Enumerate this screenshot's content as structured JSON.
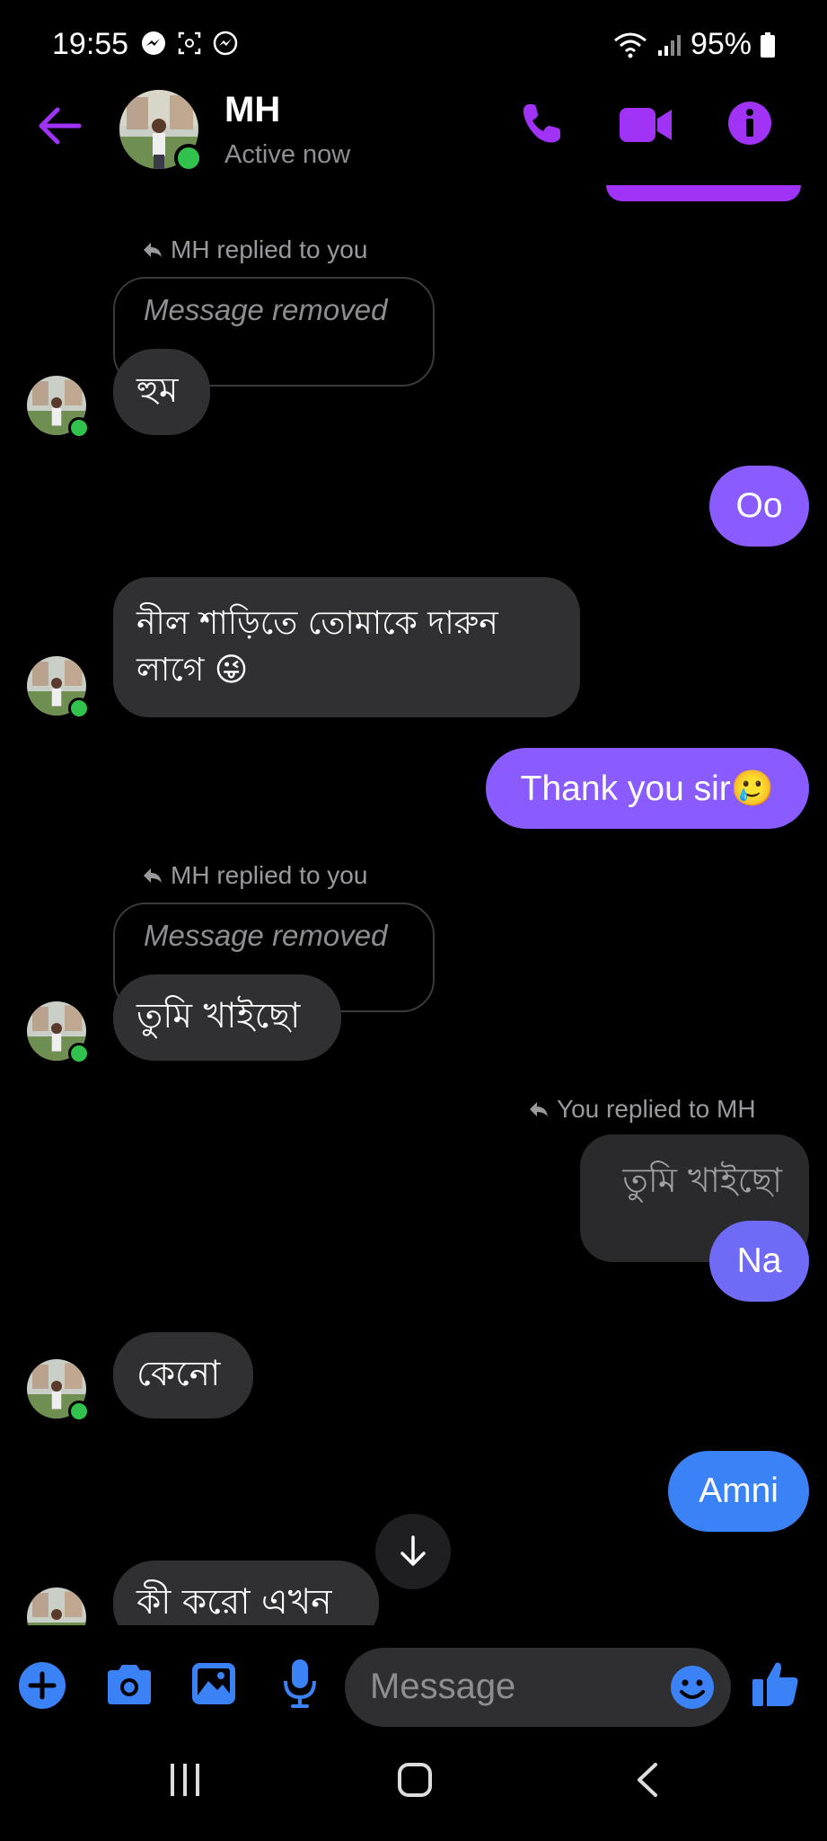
{
  "status_bar": {
    "time": "19:55",
    "battery": "95%"
  },
  "header": {
    "name": "MH",
    "status": "Active now"
  },
  "messages": {
    "m1": {
      "reply_note": "MH replied to you",
      "quoted": "Message removed",
      "text": "হুম"
    },
    "m2": {
      "text": "Oo"
    },
    "m3": {
      "line1": "নীল শাড়িতে তোমাকে দারুন",
      "line2": "লাগে 😜"
    },
    "m4": {
      "text": "Thank you sir🥲"
    },
    "m5": {
      "reply_note": "MH replied to you",
      "quoted": "Message removed",
      "text": "তুমি খাইছো"
    },
    "m6": {
      "reply_note": "You replied to MH",
      "quoted": "তুমি খাইছো",
      "text": "Na"
    },
    "m7": {
      "text": "কেনো"
    },
    "m8": {
      "text": "Amni"
    },
    "m9": {
      "text": "কী করো এখন"
    }
  },
  "composer": {
    "placeholder": "Message"
  },
  "colors": {
    "accent": "#a033f5",
    "purple_bubble": "#8a5cff",
    "blue_bubble": "#3b82f6",
    "online": "#31c24d"
  }
}
